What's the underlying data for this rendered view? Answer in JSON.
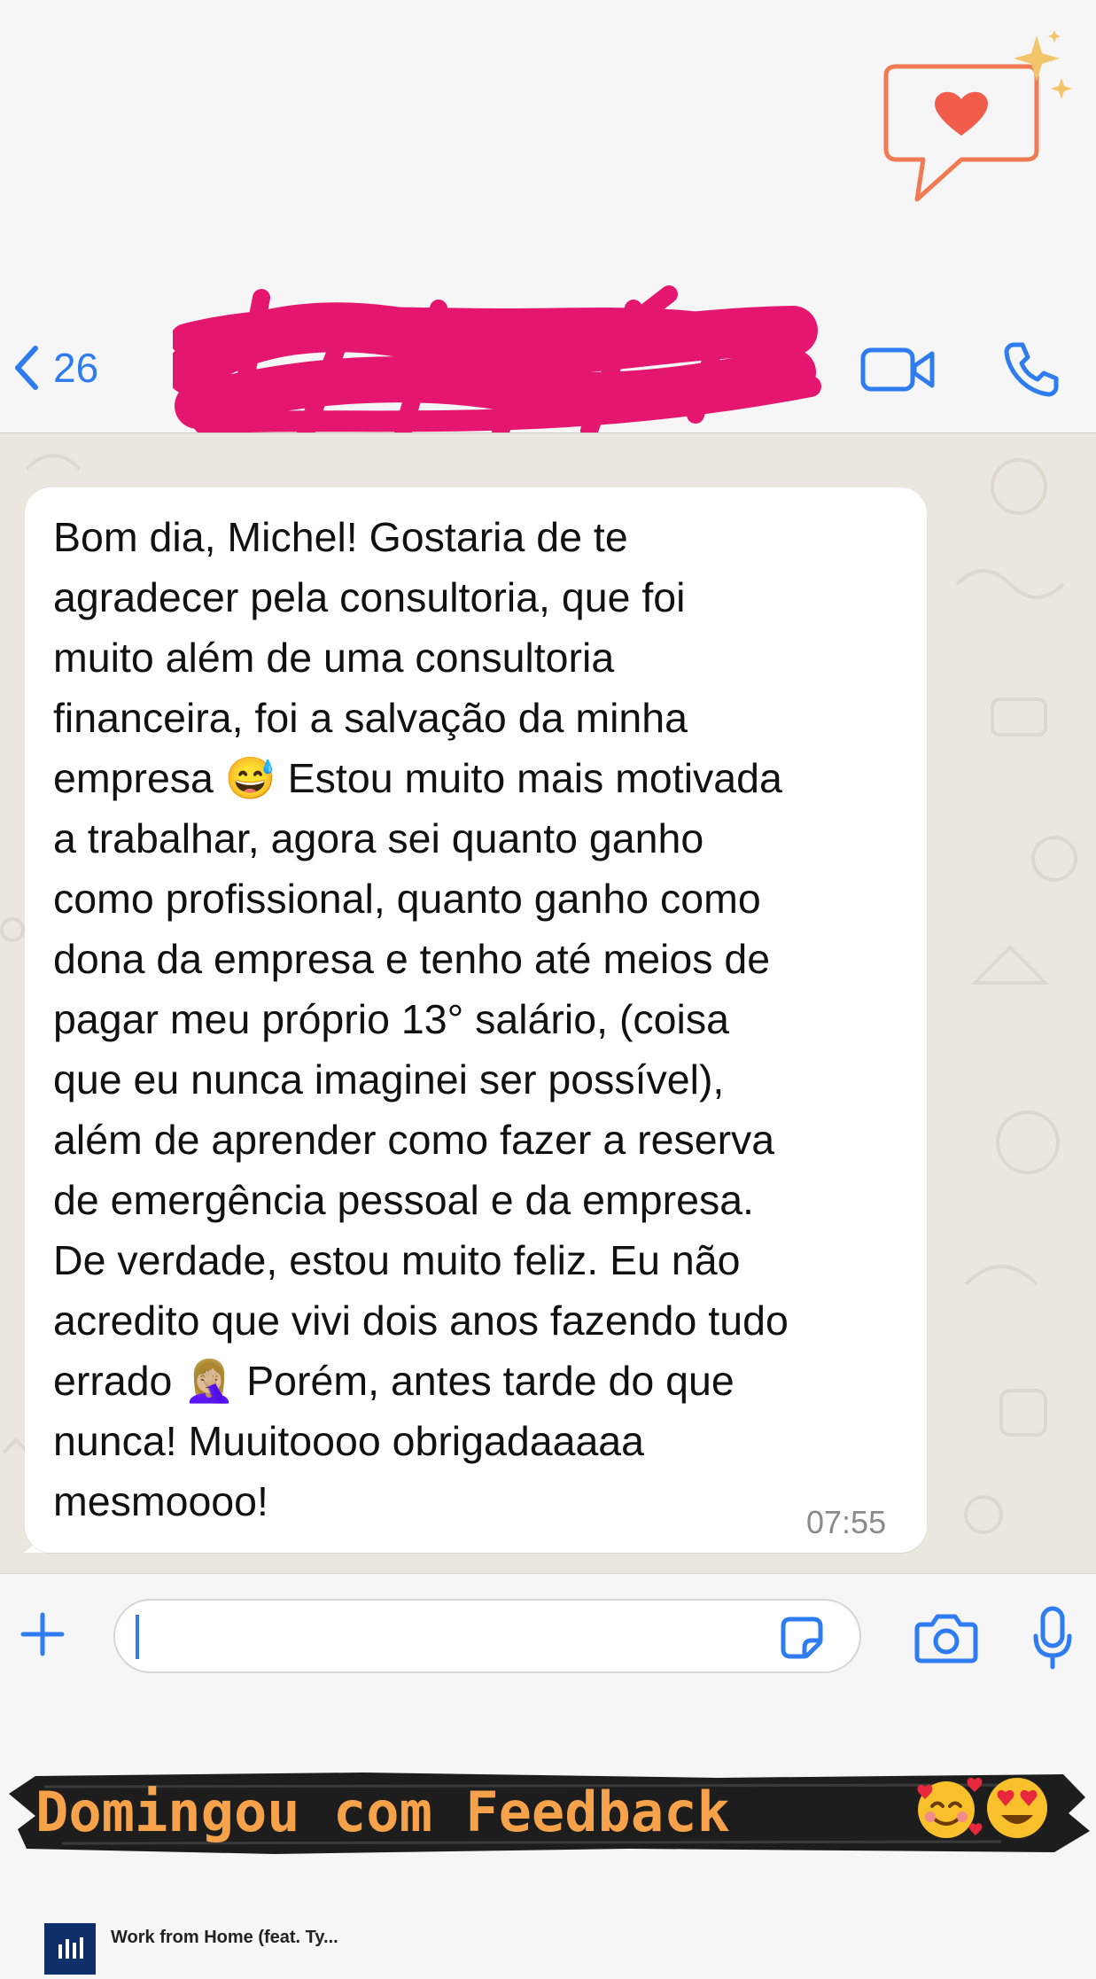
{
  "header": {
    "back_count": "26",
    "contact_name": "",
    "back_icon": "chevron-left-icon",
    "video_icon": "video-camera-icon",
    "call_icon": "phone-icon"
  },
  "message": {
    "text": "Bom dia, Michel! Gostaria de te\nagradecer pela consultoria, que foi\nmuito além de uma consultoria\nfinanceira, foi a salvação da minha\nempresa 😅 Estou muito mais motivada\na trabalhar, agora sei quanto ganho\ncomo profissional, quanto ganho como\ndona da empresa e tenho até meios de\npagar meu próprio 13° salário, (coisa\nque eu nunca imaginei ser possível),\nalém de aprender como fazer a reserva\nde emergência pessoal e da empresa.\nDe verdade, estou muito feliz. Eu não\nacredito que vivi dois anos fazendo tudo\nerrado 🤦🏼‍♀️ Porém, antes tarde do que\nnunca! Muuitoooo obrigadaaaaa\nmesmoooo!",
    "time": "07:55"
  },
  "composer": {
    "input_value": "",
    "add_icon": "plus-icon",
    "sticker_icon": "sticker-icon",
    "camera_icon": "camera-icon",
    "mic_icon": "microphone-icon"
  },
  "caption": {
    "text": "Domingou com Feedback",
    "emoji_1": "smiling-face-with-hearts-emoji",
    "emoji_2": "heart-eyes-emoji"
  },
  "music": {
    "title": "Work from Home (feat. Ty..."
  },
  "sticker": {
    "icon": "heart-speech-bubble-icon"
  },
  "colors": {
    "accent_blue": "#2f7bf0",
    "redaction_pink": "#e5166f",
    "chat_bg": "#ebe6df",
    "caption_orange": "#f6a24a"
  }
}
